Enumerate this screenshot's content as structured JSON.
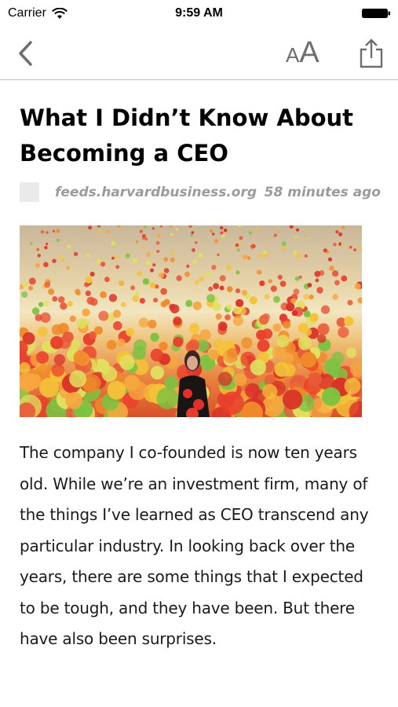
{
  "status_bar": {
    "carrier": "Carrier",
    "time": "9:59 AM",
    "icons": [
      "wifi-icon",
      "battery-icon"
    ]
  },
  "nav": {
    "back_icon": "chevron-left-icon",
    "font_small": "A",
    "font_big": "A",
    "share_icon": "share-icon",
    "tint_color": "#6d6d72"
  },
  "article": {
    "title": "What I Didn’t Know About Becoming a CEO",
    "source": "feeds.harvardbusiness.org",
    "time_ago": "58 minutes ago",
    "image_description_icon": "hero-image",
    "body": "The company I co-founded is now ten years old. While we’re an investment firm, many of the things I’ve learned as CEO transcend any particular industry. In looking back over the years, there are some things that I expected to be tough, and they have been. But there have also been surprises."
  }
}
